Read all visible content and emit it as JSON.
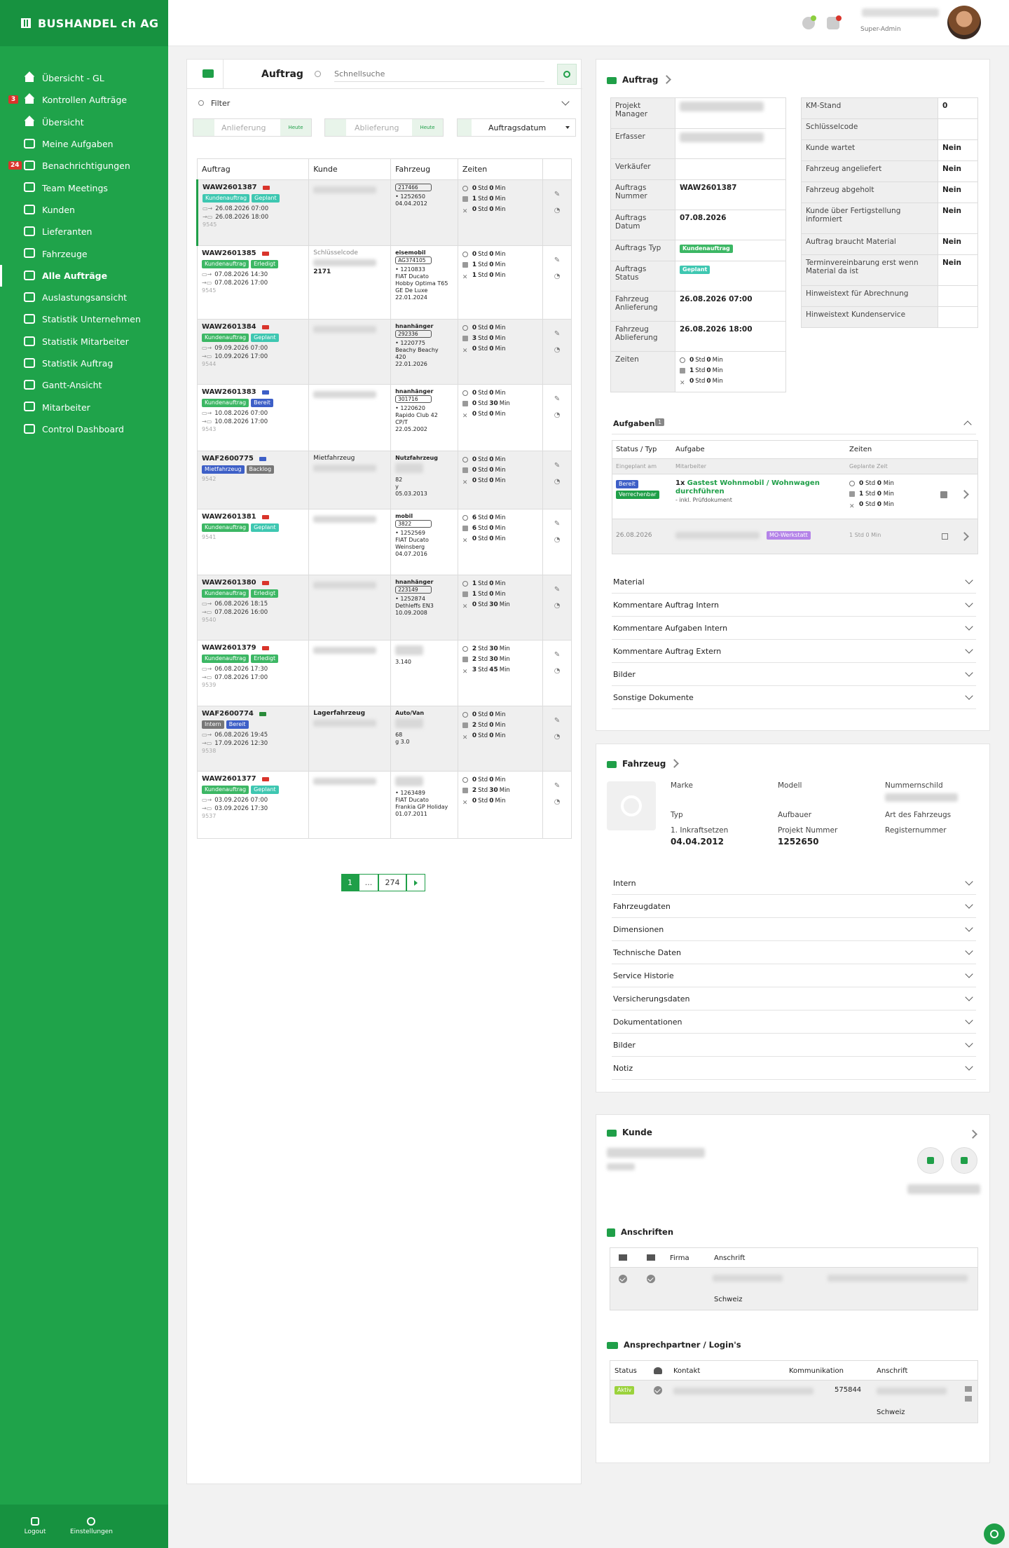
{
  "brand": "BUSHANDEL ch AG",
  "nav": [
    {
      "label": "Übersicht - GL",
      "icon": "home-icon"
    },
    {
      "label": "Kontrollen Aufträge",
      "icon": "home-icon",
      "badge": "3"
    },
    {
      "label": "Übersicht",
      "icon": "home-icon"
    },
    {
      "label": "Meine Aufgaben",
      "icon": "tools-icon"
    },
    {
      "label": "Benachrichtigungen",
      "icon": "chat-icon",
      "badge": "24"
    },
    {
      "label": "Team Meetings",
      "icon": "meeting-icon"
    },
    {
      "label": "Kunden",
      "icon": "handshake-icon"
    },
    {
      "label": "Lieferanten",
      "icon": "truck-icon"
    },
    {
      "label": "Fahrzeuge",
      "icon": "bus-icon"
    },
    {
      "label": "Alle Aufträge",
      "icon": "folder-icon",
      "active": true
    },
    {
      "label": "Auslastungsansicht",
      "icon": "bars-icon"
    },
    {
      "label": "Statistik Unternehmen",
      "icon": "chart-icon"
    },
    {
      "label": "Statistik Mitarbeiter",
      "icon": "chart-icon"
    },
    {
      "label": "Statistik Auftrag",
      "icon": "bus-icon"
    },
    {
      "label": "Gantt-Ansicht",
      "icon": "gantt-icon"
    },
    {
      "label": "Mitarbeiter",
      "icon": "users-icon"
    },
    {
      "label": "Control Dashboard",
      "icon": "dashboard-icon"
    }
  ],
  "bottom": {
    "logout": "Logout",
    "settings": "Einstellungen"
  },
  "user": {
    "role": "Super-Admin"
  },
  "list": {
    "title": "Auftrag",
    "search_placeholder": "Schnellsuche",
    "filter": "Filter",
    "anlieferung_placeholder": "Anlieferung",
    "ablieferung_placeholder": "Ablieferung",
    "heute": "Heute",
    "sort": "Auftragsdatum",
    "columns": [
      "Auftrag",
      "Kunde",
      "Fahrzeug",
      "Zeiten"
    ],
    "rows": [
      {
        "no": "WAW2601387",
        "tags": [
          [
            "Kundenauftrag",
            "teal"
          ],
          [
            "Geplant",
            "teal"
          ]
        ],
        "d1": "26.08.2026 07:00",
        "d2": "26.08.2026 18:00",
        "id": "9545",
        "kunde_label": "",
        "kunde_code": "",
        "fz_type": "",
        "fz_plate": "217466",
        "fz_lines": [
          "• 1252650",
          "04.04.2012"
        ],
        "z": [
          [
            "0",
            "0"
          ],
          [
            "1",
            "0"
          ],
          [
            "0",
            "0"
          ]
        ]
      },
      {
        "no": "WAW2601385",
        "tags": [
          [
            "Kundenauftrag",
            "green"
          ],
          [
            "Erledigt",
            "green"
          ]
        ],
        "d1": "07.08.2026 14:30",
        "d2": "07.08.2026 17:00",
        "id": "9545",
        "kunde_label": "Schlüsselcode",
        "kunde_code": "2171",
        "fz_type": "eisemobil",
        "fz_plate": "AG374105",
        "fz_lines": [
          "• 1210833",
          "FIAT Ducato",
          "Hobby Optima T65",
          "GE De Luxe",
          "22.01.2024"
        ],
        "z": [
          [
            "0",
            "0"
          ],
          [
            "1",
            "0"
          ],
          [
            "1",
            "0"
          ]
        ]
      },
      {
        "no": "WAW2601384",
        "tags": [
          [
            "Kundenauftrag",
            "green"
          ],
          [
            "Geplant",
            "teal"
          ]
        ],
        "d1": "09.09.2026 07:00",
        "d2": "10.09.2026 17:00",
        "id": "9544",
        "kunde_label": "",
        "kunde_code": "",
        "fz_type": "hnanhänger",
        "fz_plate": "292336",
        "fz_lines": [
          "• 1220775",
          "Beachy Beachy",
          "420",
          "22.01.2026"
        ],
        "z": [
          [
            "0",
            "0"
          ],
          [
            "3",
            "0"
          ],
          [
            "0",
            "0"
          ]
        ]
      },
      {
        "no": "WAW2601383",
        "tags": [
          [
            "Kundenauftrag",
            "green"
          ],
          [
            "Bereit",
            "blue"
          ]
        ],
        "d1": "10.08.2026 07:00",
        "d2": "10.08.2026 17:00",
        "id": "9543",
        "kunde_label": "",
        "kunde_code": "",
        "fz_type": "hnanhänger",
        "fz_plate": "301716",
        "fz_lines": [
          "• 1220620",
          "Rapido Club 42",
          "CP/T",
          "22.05.2002"
        ],
        "z": [
          [
            "0",
            "0"
          ],
          [
            "0",
            "30"
          ],
          [
            "0",
            "0"
          ]
        ]
      },
      {
        "no": "WAF2600775",
        "tags": [
          [
            "Mietfahrzeug",
            "blue"
          ],
          [
            "Backlog",
            "gray"
          ]
        ],
        "d1": "",
        "d2": "",
        "id": "9542",
        "kunde_label": "Mietfahrzeug",
        "kunde_code": "",
        "fz_type": "Nutzfahrzeug",
        "fz_plate": "",
        "fz_lines": [
          "82",
          "y",
          "05.03.2013"
        ],
        "z": [
          [
            "0",
            "0"
          ],
          [
            "0",
            "0"
          ],
          [
            "0",
            "0"
          ]
        ]
      },
      {
        "no": "WAW2601381",
        "tags": [
          [
            "Kundenauftrag",
            "green"
          ],
          [
            "Geplant",
            "teal"
          ]
        ],
        "d1": "",
        "d2": "",
        "id": "9541",
        "kunde_label": "",
        "kunde_code": "",
        "fz_type": "mobil",
        "fz_plate": "3822",
        "fz_lines": [
          "• 1252569",
          "FIAT Ducato",
          "Weinsberg",
          "04.07.2016"
        ],
        "z": [
          [
            "6",
            "0"
          ],
          [
            "6",
            "0"
          ],
          [
            "0",
            "0"
          ]
        ]
      },
      {
        "no": "WAW2601380",
        "tags": [
          [
            "Kundenauftrag",
            "green"
          ],
          [
            "Erledigt",
            "green"
          ]
        ],
        "d1": "06.08.2026 18:15",
        "d2": "07.08.2026 16:00",
        "id": "9540",
        "kunde_label": "",
        "kunde_code": "",
        "fz_type": "hnanhänger",
        "fz_plate": "223149",
        "fz_lines": [
          "• 1252874",
          "Dethleffs EN3",
          "10.09.2008"
        ],
        "z": [
          [
            "1",
            "0"
          ],
          [
            "1",
            "0"
          ],
          [
            "0",
            "30"
          ]
        ]
      },
      {
        "no": "WAW2601379",
        "tags": [
          [
            "Kundenauftrag",
            "green"
          ],
          [
            "Erledigt",
            "green"
          ]
        ],
        "d1": "06.08.2026 17:30",
        "d2": "07.08.2026 17:00",
        "id": "9539",
        "kunde_label": "",
        "kunde_code": "",
        "fz_type": "",
        "fz_plate": "",
        "fz_lines": [
          "3.140"
        ],
        "z": [
          [
            "2",
            "30"
          ],
          [
            "2",
            "30"
          ],
          [
            "3",
            "45"
          ]
        ]
      },
      {
        "no": "WAF2600774",
        "tags": [
          [
            "Intern",
            "gray"
          ],
          [
            "Bereit",
            "blue"
          ]
        ],
        "d1": "06.08.2026 19:45",
        "d2": "17.09.2026 12:30",
        "id": "9538",
        "kunde_label": "Lagerfahrzeug",
        "kunde_code": "",
        "fz_type": "Auto/Van",
        "fz_plate": "",
        "fz_lines": [
          "68",
          "g 3.0"
        ],
        "z": [
          [
            "0",
            "0"
          ],
          [
            "2",
            "0"
          ],
          [
            "0",
            "0"
          ]
        ]
      },
      {
        "no": "WAW2601377",
        "tags": [
          [
            "Kundenauftrag",
            "green"
          ],
          [
            "Geplant",
            "teal"
          ]
        ],
        "d1": "03.09.2026 07:00",
        "d2": "03.09.2026 17:30",
        "id": "9537",
        "kunde_label": "",
        "kunde_code": "",
        "fz_type": "",
        "fz_plate": "",
        "fz_lines": [
          "• 1263489",
          "FIAT Ducato",
          "Frankia GP Holiday",
          "01.07.2011"
        ],
        "z": [
          [
            "0",
            "0"
          ],
          [
            "2",
            "30"
          ],
          [
            "0",
            "0"
          ]
        ]
      }
    ],
    "std": "Std",
    "min": "Min",
    "pagination": [
      "1",
      "...",
      "274"
    ]
  },
  "detail": {
    "title": "Auftrag",
    "left": [
      {
        "label": "Projekt Manager",
        "value": ""
      },
      {
        "label": "Erfasser",
        "value": ""
      },
      {
        "label": "Verkäufer",
        "value": ""
      },
      {
        "label": "Auftrags Nummer",
        "value": "WAW2601387"
      },
      {
        "label": "Auftrags Datum",
        "value": "07.08.2026"
      },
      {
        "label": "Auftrags Typ",
        "value": "Kundenauftrag"
      },
      {
        "label": "Auftrags Status",
        "value": "Geplant"
      },
      {
        "label": "Fahrzeug Anlieferung",
        "value": "26.08.2026 07:00"
      },
      {
        "label": "Fahrzeug Ablieferung",
        "value": "26.08.2026 18:00"
      },
      {
        "label": "Zeiten",
        "value": ""
      }
    ],
    "right": [
      {
        "label": "KM-Stand",
        "value": "0"
      },
      {
        "label": "Schlüsselcode",
        "value": ""
      },
      {
        "label": "Kunde wartet",
        "value": "Nein"
      },
      {
        "label": "Fahrzeug angeliefert",
        "value": "Nein"
      },
      {
        "label": "Fahrzeug abgeholt",
        "value": "Nein"
      },
      {
        "label": "Kunde über Fertigstellung informiert",
        "value": "Nein"
      },
      {
        "label": "Auftrag braucht Material",
        "value": "Nein"
      },
      {
        "label": "Terminvereinbarung erst wenn Material da ist",
        "value": "Nein"
      },
      {
        "label": "Hinweistext für Abrechnung",
        "value": ""
      },
      {
        "label": "Hinweistext Kundenservice",
        "value": ""
      }
    ],
    "aufgaben": {
      "title": "Aufgaben",
      "count": "1",
      "head": [
        "Status / Typ",
        "Aufgabe",
        "Zeiten"
      ],
      "sub": [
        "Eingeplant am",
        "Mitarbeiter",
        "Geplante Zeit"
      ],
      "task_qty": "1x",
      "task_name": "Gastest Wohnmobil / Wohnwagen durchführen",
      "task_sub": "- inkl. Prüfdokument",
      "task_tags": [
        "Bereit",
        "Verrechenbar"
      ],
      "date": "26.08.2026",
      "team": "MO-Werkstatt",
      "team_time": "1 Std 0 Min"
    },
    "sections": [
      "Material",
      "Kommentare Auftrag Intern",
      "Kommentare Aufgaben Intern",
      "Kommentare Auftrag Extern",
      "Bilder",
      "Sonstige Dokumente"
    ]
  },
  "fahrzeug": {
    "title": "Fahrzeug",
    "labels": {
      "marke": "Marke",
      "modell": "Modell",
      "schild": "Nummernschild",
      "typ": "Typ",
      "aufbauer": "Aufbauer",
      "art": "Art des Fahrzeugs",
      "inkraft": "1. Inkraftsetzen",
      "projekt": "Projekt Nummer",
      "register": "Registernummer"
    },
    "values": {
      "inkraft": "04.04.2012",
      "projekt": "1252650"
    },
    "sections": [
      "Intern",
      "Fahrzeugdaten",
      "Dimensionen",
      "Technische Daten",
      "Service Historie",
      "Versicherungsdaten",
      "Dokumentationen",
      "Bilder",
      "Notiz"
    ]
  },
  "kunde": {
    "title": "Kunde",
    "anschriften": {
      "title": "Anschriften",
      "cols": [
        "Firma",
        "Anschrift"
      ],
      "country": "Schweiz"
    },
    "ansprech": {
      "title": "Ansprechpartner / Login's",
      "cols": [
        "Status",
        "Kontakt",
        "Kommunikation",
        "Anschrift"
      ],
      "status": "Aktiv",
      "phone_tail": "575844",
      "country": "Schweiz"
    }
  }
}
